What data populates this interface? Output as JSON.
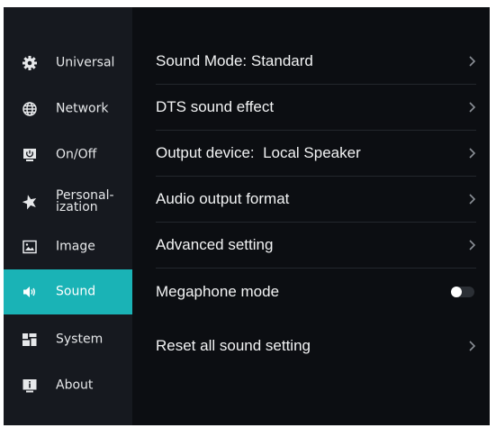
{
  "sidebar": {
    "items": [
      {
        "label": "Universal",
        "icon": "gear-icon",
        "active": false
      },
      {
        "label": "Network",
        "icon": "globe-icon",
        "active": false
      },
      {
        "label": "On/Off",
        "icon": "power-icon",
        "active": false
      },
      {
        "label": "Personal-\nization",
        "icon": "star-icon",
        "active": false
      },
      {
        "label": "Image",
        "icon": "image-icon",
        "active": false
      },
      {
        "label": "Sound",
        "icon": "speaker-icon",
        "active": true
      },
      {
        "label": "System",
        "icon": "grid-icon",
        "active": false
      },
      {
        "label": "About",
        "icon": "info-icon",
        "active": false
      }
    ]
  },
  "main": {
    "rows": [
      {
        "label": "Sound Mode: Standard",
        "control": "chevron"
      },
      {
        "label": "DTS sound effect",
        "control": "chevron"
      },
      {
        "label": "Output device:  Local Speaker",
        "control": "chevron"
      },
      {
        "label": "Audio output format",
        "control": "chevron"
      },
      {
        "label": "Advanced setting",
        "control": "chevron"
      },
      {
        "label": "Megaphone mode",
        "control": "toggle",
        "value": "off"
      },
      {
        "label": "Reset all sound setting",
        "control": "chevron"
      }
    ]
  },
  "colors": {
    "accent": "#1ab3b6",
    "background": "#0c0e12",
    "sidebar": "#16191f"
  }
}
